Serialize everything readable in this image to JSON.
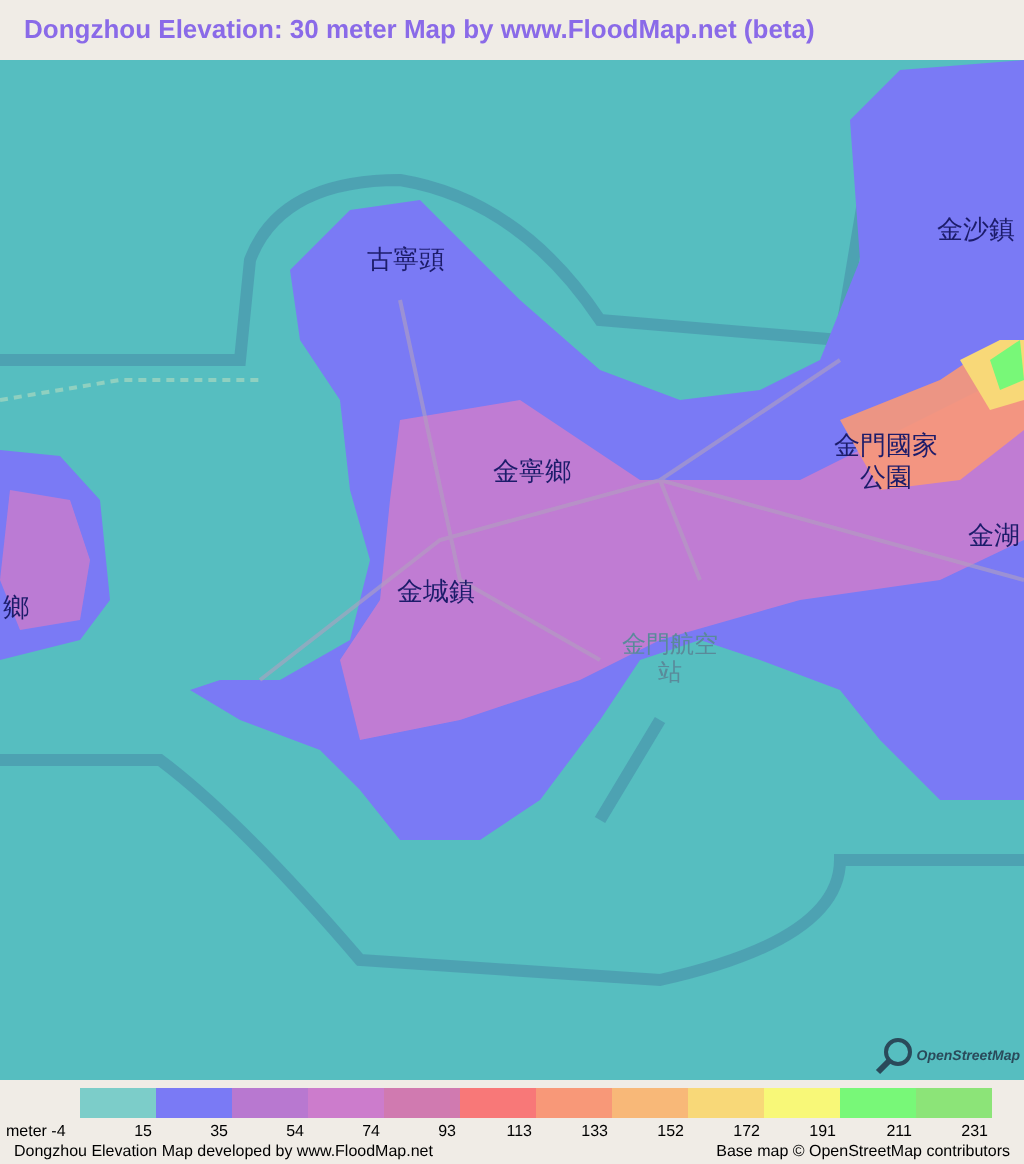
{
  "title": "Dongzhou Elevation: 30 meter Map by www.FloodMap.net (beta)",
  "map": {
    "place_labels": [
      {
        "text": "古寧頭",
        "kind": "place"
      },
      {
        "text": "金沙鎮",
        "kind": "place"
      },
      {
        "text": "金寧鄉",
        "kind": "place"
      },
      {
        "text": "金門國家",
        "kind": "place"
      },
      {
        "text": "公園",
        "kind": "place"
      },
      {
        "text": "金湖",
        "kind": "place"
      },
      {
        "text": "金城鎮",
        "kind": "place"
      },
      {
        "text": "金門航空",
        "kind": "airport"
      },
      {
        "text": "站",
        "kind": "airport"
      },
      {
        "text": "鄉",
        "kind": "place"
      }
    ],
    "logo_text": "OpenStreetMap"
  },
  "legend": {
    "swatches": [
      {
        "color": "#7ccdc9"
      },
      {
        "color": "#7a7af5"
      },
      {
        "color": "#b878d0"
      },
      {
        "color": "#cc7ccc"
      },
      {
        "color": "#d07ab0"
      },
      {
        "color": "#f87878"
      },
      {
        "color": "#f89878"
      },
      {
        "color": "#f8b878"
      },
      {
        "color": "#f8d878"
      },
      {
        "color": "#f8f878"
      },
      {
        "color": "#78f878"
      },
      {
        "color": "#8ce478"
      }
    ],
    "labels": [
      "meter -4",
      "15",
      "35",
      "54",
      "74",
      "93",
      "113",
      "133",
      "152",
      "172",
      "191",
      "211",
      "231"
    ]
  },
  "footer": {
    "credit": "Dongzhou Elevation Map developed by www.FloodMap.net",
    "attribution": "Base map © OpenStreetMap contributors"
  }
}
